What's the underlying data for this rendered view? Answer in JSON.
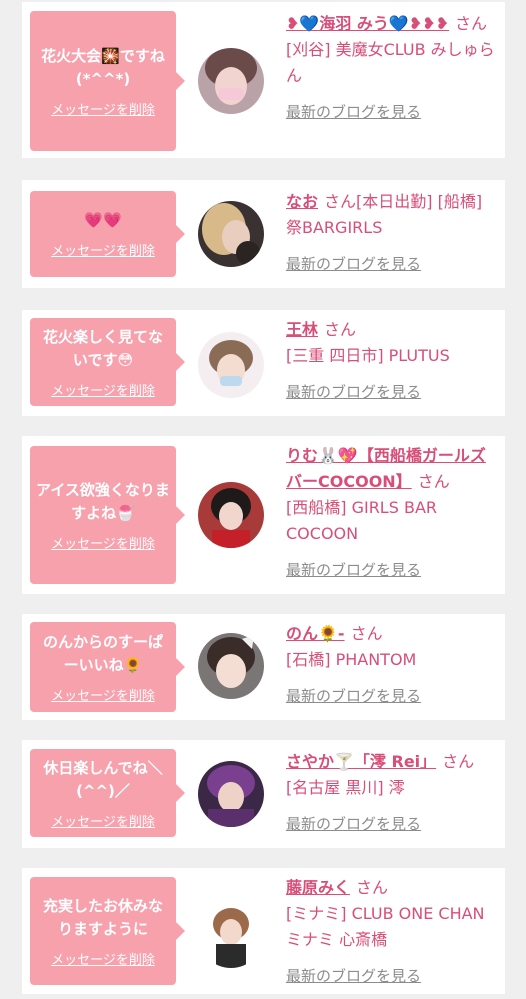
{
  "delete_label": "メッセージを削除",
  "blog_label": "最新のブログを見る",
  "san": "さん",
  "colors": {
    "bubble": "#f7a1ad",
    "name": "#d94e78",
    "link_gray": "#8c8c8c",
    "background": "#efefef"
  },
  "items": [
    {
      "message": "花火大会🎇ですね(*^^*)",
      "name": "❥💙海羽 みう💙❥❥❥",
      "shop": "[刈谷] 美魔女CLUB みしゅらん"
    },
    {
      "message": "💗💗",
      "name": "なお",
      "shop": "[本日出勤] [船橋] 祭BARGIRLS"
    },
    {
      "message": "花火楽しく見てないです😳",
      "name": "王林",
      "shop": "[三重 四日市] PLUTUS"
    },
    {
      "message": "アイス欲強くなりますよね🍧",
      "name": "りむ🐰💖【西船橋ガールズバーCOCOON】",
      "shop": "[西船橋] GIRLS BAR COCOON"
    },
    {
      "message": "のんからのすーぱーいいね🌻",
      "name": "のん🌻‐",
      "shop": "[石橋] PHANTOM"
    },
    {
      "message": "休日楽しんでね＼(^^)／",
      "name": "さやか🍸「澪 Rei」",
      "shop": "[名古屋 黒川] 澪"
    },
    {
      "message": "充実したお休みなりますように",
      "name": "藤原みく",
      "shop": "[ミナミ] CLUB ONE CHAN ミナミ 心斎橋"
    }
  ]
}
